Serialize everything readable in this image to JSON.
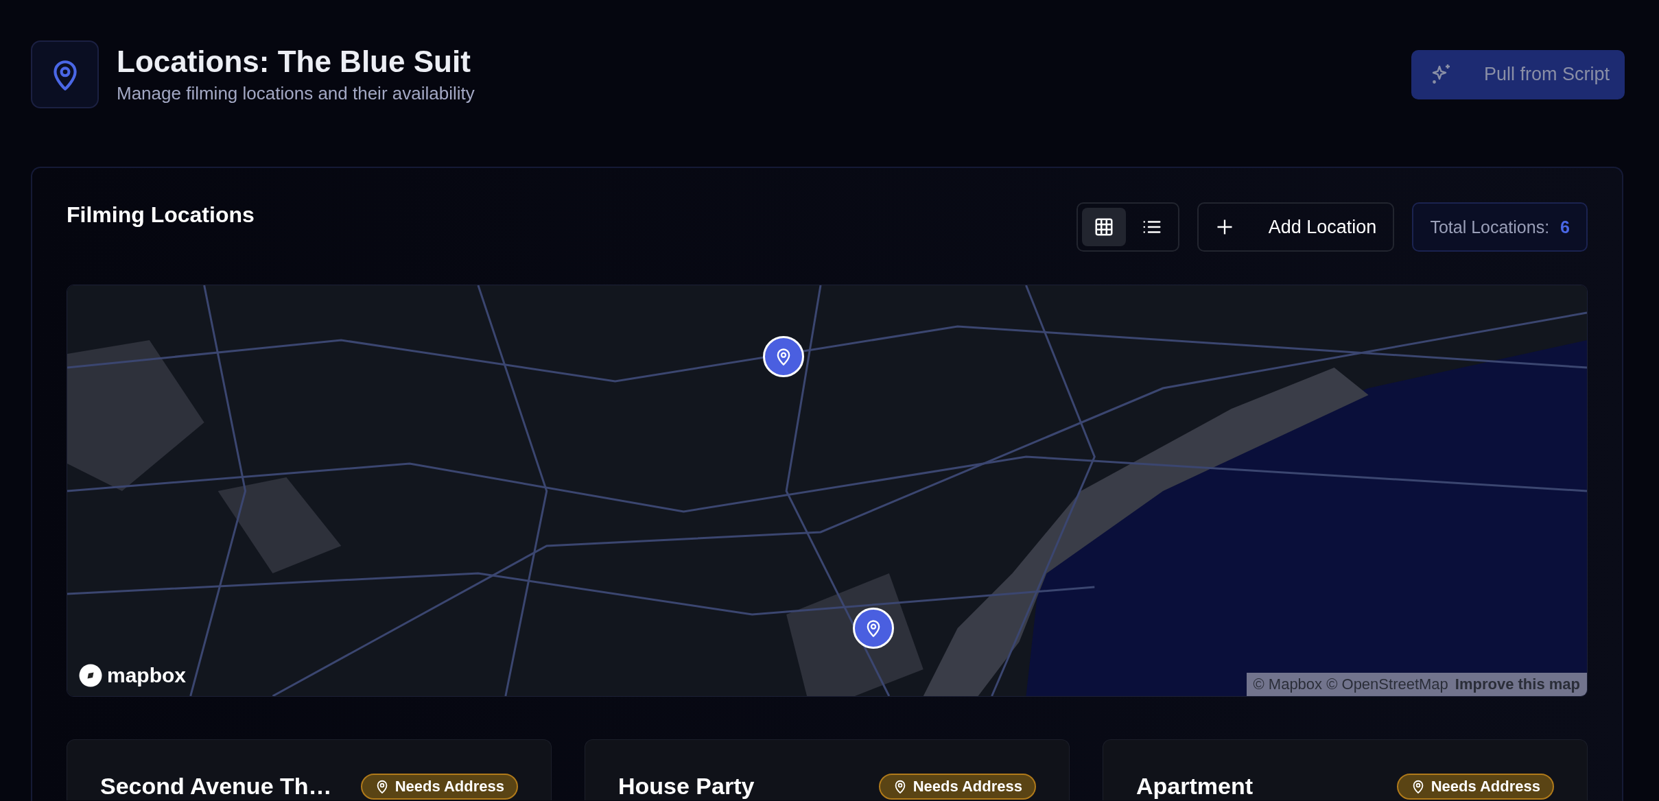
{
  "header": {
    "title": "Locations: The Blue Suit",
    "subtitle": "Manage filming locations and their availability",
    "action": {
      "label": "Pull from Script",
      "disabled": true
    }
  },
  "panel": {
    "title": "Filming Locations",
    "view_modes": [
      {
        "kind": "grid",
        "selected": true
      },
      {
        "kind": "list",
        "selected": false
      }
    ],
    "add_button": "Add Location",
    "total": {
      "label": "Total Locations:",
      "count": "6"
    },
    "map": {
      "kind": "picture",
      "logo": "mapbox",
      "attribution": "© Mapbox © OpenStreetMap",
      "improve_link": "Improve this map"
    },
    "cards": [
      {
        "name": "Second Avenue Th…",
        "status": "Needs Address"
      },
      {
        "name": "House Party",
        "status": "Needs Address"
      },
      {
        "name": "Apartment",
        "status": "Needs Address"
      }
    ]
  }
}
